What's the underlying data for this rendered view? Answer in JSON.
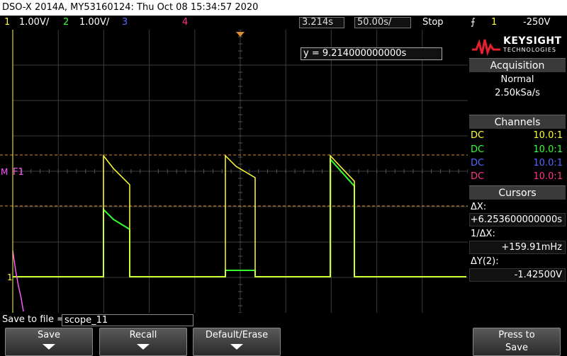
{
  "title": "DSO-X 2014A, MY53160124: Thu Oct 08 15:34:57 2020",
  "status": {
    "ch1": {
      "num": "1",
      "scale": "1.00V/",
      "color": "#ffff33"
    },
    "ch2": {
      "num": "2",
      "scale": "1.00V/",
      "color": "#33ff33"
    },
    "ch3": {
      "num": "3",
      "color": "#5566ff"
    },
    "ch4": {
      "num": "4",
      "color": "#ff3388"
    },
    "time_pos": "3.214s",
    "time_scale": "50.00s/",
    "run_state": "Stop",
    "trigger_icon": "trigger-edge-icon",
    "trigger_ch": "1",
    "trigger_level": "-250",
    "trigger_level_suffix": "V"
  },
  "screen": {
    "cursor_readout": "y = 9.214000000000s",
    "marker_f1": "F1",
    "marker_m": "M",
    "marker_1": "1",
    "colors": {
      "grid": "#3a3a3a",
      "ch1": "#ffff33",
      "ch2": "#33ff33",
      "cursor": "#e08a30",
      "math": "#ff55ff"
    }
  },
  "panel": {
    "logo_line1": "KEYSIGHT",
    "logo_line2": "TECHNOLOGIES",
    "acquisition": {
      "header": "Acquisition",
      "mode": "Normal",
      "rate": "2.50kSa/s"
    },
    "channels": {
      "header": "Channels",
      "rows": [
        {
          "coupling": "DC",
          "probe": "10.0:1",
          "color": "#ffff33"
        },
        {
          "coupling": "DC",
          "probe": "10.0:1",
          "color": "#33ff33"
        },
        {
          "coupling": "DC",
          "probe": "10.0:1",
          "color": "#5566ff"
        },
        {
          "coupling": "DC",
          "probe": "10.0:1",
          "color": "#ff3388"
        }
      ]
    },
    "cursors": {
      "header": "Cursors",
      "dx_label": "ΔX:",
      "dx_value": "+6.253600000000s",
      "inv_dx_label": "1/ΔX:",
      "inv_dx_value": "+159.91mHz",
      "dy_label": "ΔY(2):",
      "dy_value": "-1.42500V"
    }
  },
  "file": {
    "label": "Save to file =",
    "value": "scope_11"
  },
  "softkeys": {
    "save": "Save",
    "recall": "Recall",
    "default_erase": "Default/Erase",
    "press_to": "Press to",
    "save2": "Save"
  }
}
